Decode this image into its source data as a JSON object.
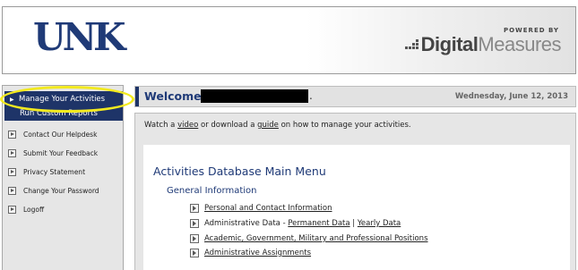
{
  "header": {
    "logo_text": "UNK",
    "powered_by": "POWERED BY",
    "digital": "Digital",
    "measures": "Measures"
  },
  "sidebar": {
    "active_item": "Manage Your Activities",
    "active_sub": "Run Custom Reports",
    "items": [
      {
        "label": "Contact Our Helpdesk"
      },
      {
        "label": "Submit Your Feedback"
      },
      {
        "label": "Privacy Statement"
      },
      {
        "label": "Change Your Password"
      },
      {
        "label": "Logoff"
      }
    ]
  },
  "welcome": {
    "title": "Welcome,",
    "punct": ".",
    "date": "Wednesday, June 12, 2013"
  },
  "intro": {
    "pre": "Watch a ",
    "video_link": "video",
    "mid": " or download a ",
    "guide_link": "guide",
    "post": " on how to manage your activities."
  },
  "menu": {
    "title": "Activities Database Main Menu",
    "section": "General Information",
    "entries": [
      {
        "link": "Personal and Contact Information"
      },
      {
        "prefix": "Administrative Data - ",
        "link": "Permanent Data",
        "sep": " | ",
        "link2": "Yearly Data"
      },
      {
        "link": "Academic, Government, Military and Professional Positions"
      },
      {
        "link": "Administrative Assignments"
      }
    ]
  },
  "colors": {
    "brand_navy": "#1f3a77",
    "nav_active_bg": "#1e3468",
    "highlight_ring": "#f3ea1f"
  }
}
